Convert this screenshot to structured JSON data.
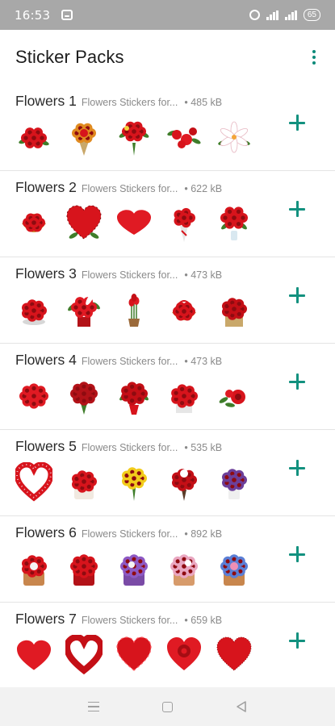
{
  "status_bar": {
    "time": "16:53",
    "battery": "65"
  },
  "app_bar": {
    "title": "Sticker Packs"
  },
  "packs": [
    {
      "name": "Flowers 1",
      "author": "Flowers Stickers for...",
      "size": "• 485 kB",
      "stickers": [
        "rose-bunch",
        "rose-bouquet",
        "mixed-bouquet",
        "scattered-roses",
        "white-lily"
      ]
    },
    {
      "name": "Flowers 2",
      "author": "Flowers Stickers for...",
      "size": "• 622 kB",
      "stickers": [
        "rose-basket",
        "rose-heart",
        "rose-heart-flat",
        "rose-bouquet-tall",
        "roses-in-vase"
      ]
    },
    {
      "name": "Flowers 3",
      "author": "Flowers Stickers for...",
      "size": "• 473 kB",
      "stickers": [
        "rose-dome",
        "lily-arrangement",
        "tulip-pot",
        "rose-basket-handle",
        "rose-box"
      ]
    },
    {
      "name": "Flowers 4",
      "author": "Flowers Stickers for...",
      "size": "• 473 kB",
      "stickers": [
        "rose-dome-big",
        "rose-bouquet-dark",
        "rose-vase-mix",
        "rose-box-wide",
        "rose-spray"
      ]
    },
    {
      "name": "Flowers 5",
      "author": "Flowers Stickers for...",
      "size": "• 535 kB",
      "stickers": [
        "heart-wreath",
        "hat-box-roses",
        "yellow-roses",
        "red-white-bouquet",
        "purple-flowers"
      ]
    },
    {
      "name": "Flowers 6",
      "author": "Flowers Stickers for...",
      "size": "• 892 kB",
      "stickers": [
        "bear-box",
        "red-box",
        "violet-box",
        "pastel-box",
        "blue-pink-box"
      ]
    },
    {
      "name": "Flowers 7",
      "author": "Flowers Stickers for...",
      "size": "• 659 kB",
      "stickers": [
        "red-heart",
        "heart-ring",
        "petal-heart",
        "rose-heart-center",
        "rough-heart"
      ]
    }
  ],
  "colors": {
    "accent": "#13917f",
    "rose": "#d7141c",
    "leaf": "#3f7d2a",
    "status_bar": "#a8a8a8"
  }
}
